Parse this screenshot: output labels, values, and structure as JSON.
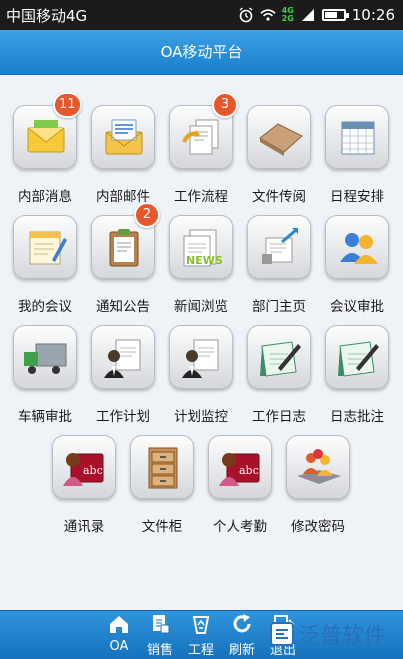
{
  "status_bar": {
    "carrier": "中国移动4G",
    "network_small_top": "4G",
    "network_small_bottom": "2G",
    "time": "10:26",
    "battery_level": 0.7
  },
  "header": {
    "title": "OA移动平台"
  },
  "grid": {
    "rows": [
      [
        {
          "id": "internal-message",
          "label": "内部消息",
          "icon": "envelope-yellow-icon",
          "badge": "11"
        },
        {
          "id": "internal-mail",
          "label": "内部邮件",
          "icon": "mail-letter-icon",
          "badge": ""
        },
        {
          "id": "workflow",
          "label": "工作流程",
          "icon": "workflow-docs-icon",
          "badge": "3"
        },
        {
          "id": "file-review",
          "label": "文件传阅",
          "icon": "folder-brown-icon",
          "badge": ""
        },
        {
          "id": "schedule",
          "label": "日程安排",
          "icon": "calendar-icon",
          "badge": ""
        }
      ],
      [
        {
          "id": "my-meetings",
          "label": "我的会议",
          "icon": "notepad-pencil-icon",
          "badge": ""
        },
        {
          "id": "notices",
          "label": "通知公告",
          "icon": "clipboard-icon",
          "badge": "2"
        },
        {
          "id": "news",
          "label": "新闻浏览",
          "icon": "news-icon",
          "badge": ""
        },
        {
          "id": "dept-home",
          "label": "部门主页",
          "icon": "dept-arrow-icon",
          "badge": ""
        },
        {
          "id": "meeting-approve",
          "label": "会议审批",
          "icon": "people-group-icon",
          "badge": ""
        }
      ],
      [
        {
          "id": "vehicle-approve",
          "label": "车辆审批",
          "icon": "truck-icon",
          "badge": ""
        },
        {
          "id": "work-plan",
          "label": "工作计划",
          "icon": "person-document-icon",
          "badge": ""
        },
        {
          "id": "plan-monitor",
          "label": "计划监控",
          "icon": "person-document-icon",
          "badge": ""
        },
        {
          "id": "work-log",
          "label": "工作日志",
          "icon": "pen-notebook-icon",
          "badge": ""
        },
        {
          "id": "log-annotate",
          "label": "日志批注",
          "icon": "pen-notebook-icon",
          "badge": ""
        }
      ],
      [
        {
          "id": "contacts",
          "label": "通讯录",
          "icon": "address-book-icon",
          "badge": ""
        },
        {
          "id": "file-cabinet",
          "label": "文件柜",
          "icon": "file-cabinet-icon",
          "badge": ""
        },
        {
          "id": "attendance",
          "label": "个人考勤",
          "icon": "address-book-icon",
          "badge": ""
        },
        {
          "id": "change-password",
          "label": "修改密码",
          "icon": "users-key-icon",
          "badge": ""
        }
      ]
    ]
  },
  "bottom_nav": {
    "items": [
      {
        "id": "oa",
        "label": "OA",
        "icon": "home-icon"
      },
      {
        "id": "sales",
        "label": "销售",
        "icon": "sales-doc-icon"
      },
      {
        "id": "project",
        "label": "工程",
        "icon": "recycle-icon"
      },
      {
        "id": "refresh",
        "label": "刷新",
        "icon": "refresh-icon"
      },
      {
        "id": "logout",
        "label": "退出",
        "icon": "logout-icon"
      }
    ]
  },
  "watermark": {
    "text": "泛普软件"
  },
  "colors": {
    "header_blue": "#1a7fca",
    "badge_red": "#e8562c",
    "background": "#eef3f8"
  }
}
